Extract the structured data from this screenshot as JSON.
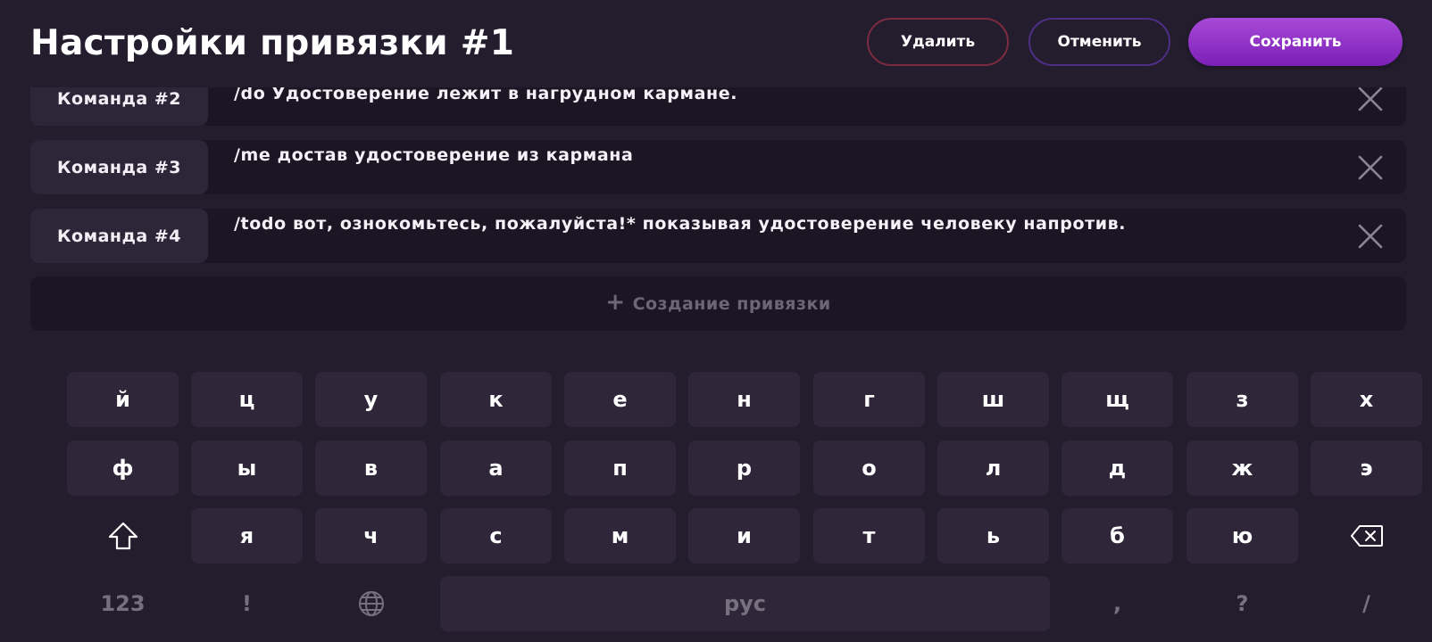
{
  "header": {
    "title": "Настройки привязки #1",
    "delete_label": "Удалить",
    "cancel_label": "Отменить",
    "save_label": "Сохранить"
  },
  "commands": [
    {
      "label": "Команда #2",
      "text": "/do Удостоверение лежит в нагрудном кармане."
    },
    {
      "label": "Команда #3",
      "text": "/me достав удостоверение из кармана"
    },
    {
      "label": "Команда #4",
      "text": "/todo вот, ознокомьтесь, пожалуйста!* показывая удостоверение человеку напротив."
    }
  ],
  "add_binding": {
    "plus": "+",
    "label": "Создание привязки"
  },
  "keyboard": {
    "row1": [
      "й",
      "ц",
      "у",
      "к",
      "е",
      "н",
      "г",
      "ш",
      "щ",
      "з",
      "х"
    ],
    "row2": [
      "ф",
      "ы",
      "в",
      "а",
      "п",
      "р",
      "о",
      "л",
      "д",
      "ж",
      "э"
    ],
    "row3": [
      "я",
      "ч",
      "с",
      "м",
      "и",
      "т",
      "ь",
      "б",
      "ю"
    ],
    "row4": {
      "numbers": "123",
      "exclamation": "!",
      "space": "рус",
      "comma": ",",
      "question": "?",
      "slash": "/"
    },
    "icons": {
      "shift": "shift-icon",
      "backspace": "backspace-icon",
      "language": "globe-icon",
      "remove": "close-icon"
    }
  },
  "colors": {
    "background": "#231d2e",
    "row_bg": "#1b1623",
    "key_bg": "#2f2739",
    "delete_border": "#7a2c3e",
    "cancel_border": "#4f2e86",
    "save_gradient_top": "#a84ad8",
    "save_gradient_bottom": "#7b1fb6"
  }
}
